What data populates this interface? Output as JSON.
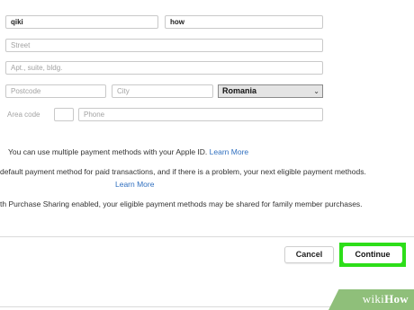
{
  "form": {
    "first_name": "qiki",
    "last_name": "how",
    "street_placeholder": "Street",
    "apt_placeholder": "Apt., suite, bldg.",
    "postcode_placeholder": "Postcode",
    "city_placeholder": "City",
    "country_selected": "Romania",
    "area_code_label": "Area code",
    "phone_placeholder": "Phone"
  },
  "info": {
    "line1_text": "You can use multiple payment methods with your Apple ID.",
    "line1_link": "Learn More",
    "line2_text": "default payment method for paid transactions, and if there is a problem, your next eligible payment methods.",
    "line2_link": "Learn More",
    "line3_text": "th Purchase Sharing enabled, your eligible payment methods may be shared for family member purchases."
  },
  "buttons": {
    "cancel": "Cancel",
    "continue": "Continue"
  },
  "colors": {
    "highlight": "#2dde19",
    "link": "#2f6fbf"
  }
}
